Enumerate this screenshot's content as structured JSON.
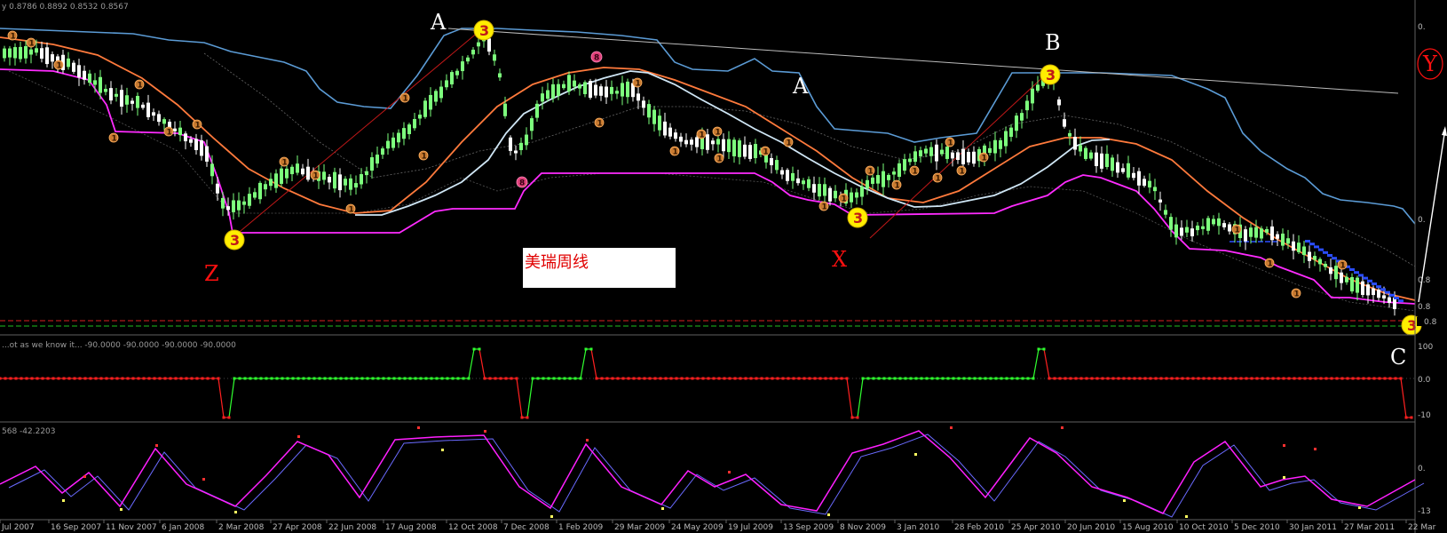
{
  "window": {
    "main_header": "y  0.8786 0.8892 0.8532 0.8567",
    "ind1_header": "...ot as we know it... -90.0000 -90.0000 -90.0000 -90.0000",
    "ind2_header": "568 -42.2203",
    "price_tag": "0.8",
    "note_text": "美瑞周线"
  },
  "wave_labels": {
    "A1": "A",
    "A2": "A",
    "B": "B",
    "C": "C",
    "X": "X",
    "Y": "Y",
    "Z": "Z"
  },
  "markers": {
    "three": "3",
    "one": "1",
    "eight": "8"
  },
  "x_axis": {
    "labels": [
      "Jul 2007",
      "16 Sep 2007",
      "11 Nov 2007",
      "6 Jan 2008",
      "2 Mar 2008",
      "27 Apr 2008",
      "22 Jun 2008",
      "17 Aug 2008",
      "12 Oct 2008",
      "7 Dec 2008",
      "1 Feb 2009",
      "29 Mar 2009",
      "24 May 2009",
      "19 Jul 2009",
      "13 Sep 2009",
      "8 Nov 2009",
      "3 Jan 2010",
      "28 Feb 2010",
      "25 Apr 2010",
      "20 Jun 2010",
      "15 Aug 2010",
      "10 Oct 2010",
      "5 Dec 2010",
      "30 Jan 2011",
      "27 Mar 2011",
      "22 Mar"
    ]
  },
  "y_axis": {
    "main": [
      "0.",
      "0.",
      "0.8",
      "0.8"
    ],
    "ind1": [
      "100",
      "0.0",
      "-10"
    ],
    "ind2": [
      "0.",
      "-13"
    ]
  },
  "colors": {
    "background": "#000000",
    "bull_candle": "#7dff7d",
    "bear_candle": "#ffffff",
    "ma_orange": "#ff7a3c",
    "ma_lightblue": "#cfe6f5",
    "support_magenta": "#ff2bff",
    "resistance_blue": "#5b9bd5",
    "trend_red": "#d02020",
    "signal_red": "#ff2020",
    "signal_green": "#30ff30",
    "stoch_main": "#ff1fff",
    "stoch_signal": "#6a6aff",
    "marker_yellow": "#ffee00",
    "marker_orange": "#c87a30"
  }
}
